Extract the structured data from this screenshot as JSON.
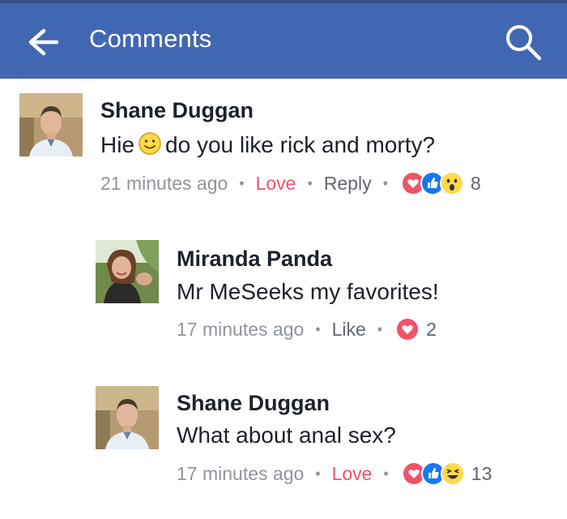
{
  "header": {
    "title": "Comments",
    "back_icon": "arrow-left-icon",
    "search_icon": "search-icon",
    "bg_color": "#4267b2"
  },
  "comments": [
    {
      "author": "Shane Duggan",
      "text_before_emoji": "Hie",
      "emoji": "slight-smile-emoji",
      "text_after_emoji": "do you like rick and morty?",
      "time": "21 minutes ago",
      "actions": [
        "Love",
        "Reply"
      ],
      "reactions": [
        "love-reaction-icon",
        "like-reaction-icon",
        "wow-reaction-icon"
      ],
      "reaction_count": "8"
    },
    {
      "author": "Miranda Panda",
      "text": "Mr MeSeeks my favorites!",
      "time": "17 minutes ago",
      "actions": [
        "Like"
      ],
      "reactions": [
        "love-reaction-icon"
      ],
      "reaction_count": "2"
    },
    {
      "author": "Shane Duggan",
      "text": "What about anal sex?",
      "time": "17 minutes ago",
      "actions": [
        "Love"
      ],
      "reactions": [
        "love-reaction-icon",
        "like-reaction-icon",
        "haha-reaction-icon"
      ],
      "reaction_count": "13"
    }
  ],
  "colors": {
    "love": "#f25268",
    "like_blue": "#1877f2",
    "meta_gray": "#90949c"
  }
}
